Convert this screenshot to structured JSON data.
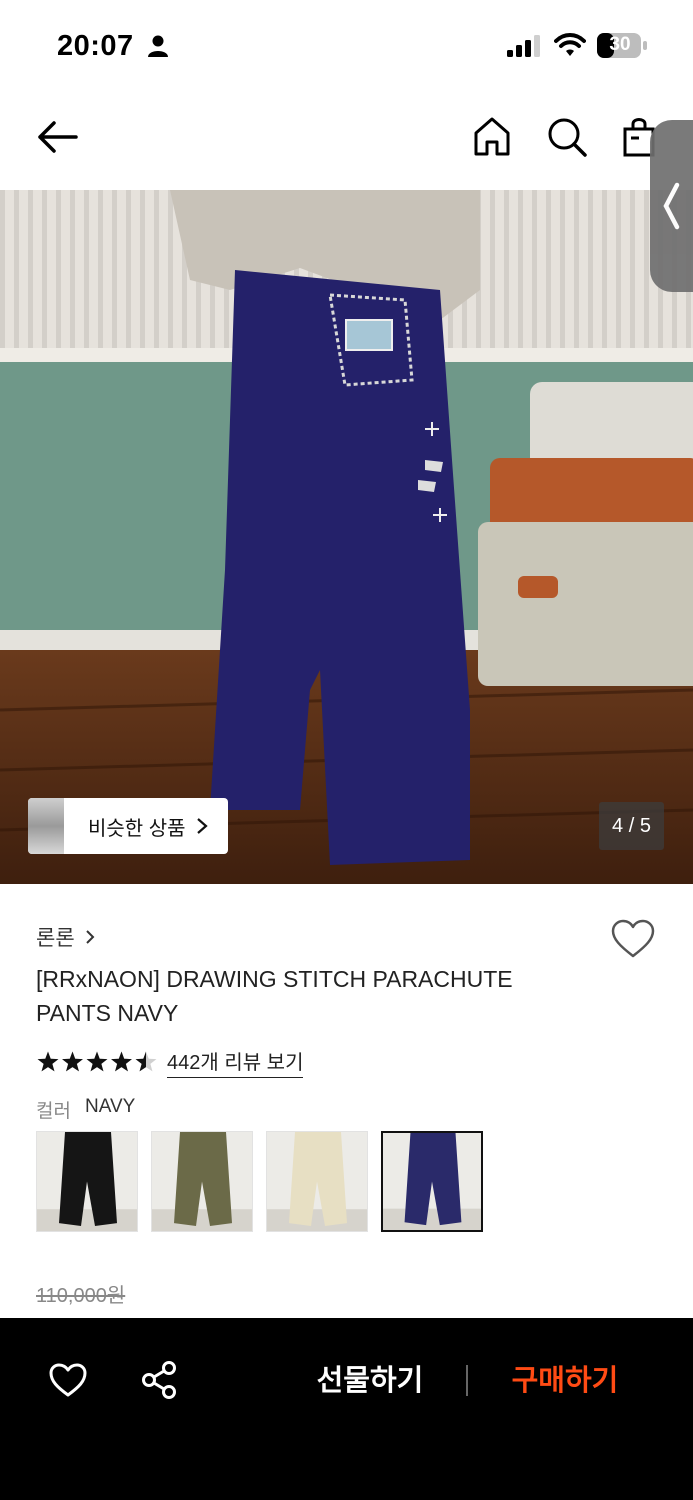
{
  "status_bar": {
    "time": "20:07",
    "battery": "30"
  },
  "nav": {
    "icons": [
      "back-arrow-icon",
      "home-icon",
      "search-icon",
      "shopping-bag-icon",
      "chevron-left-icon"
    ]
  },
  "hero": {
    "similar_label": "비슷한 상품",
    "page_indicator": "4 / 5"
  },
  "product": {
    "brand": "론론",
    "title": "[RRxNAON] DRAWING STITCH PARACHUTE PANTS NAVY",
    "rating_stars": 4.5,
    "review_link": "442개 리뷰 보기",
    "color_label": "컬러",
    "color_value": "NAVY",
    "swatch_colors": [
      "#151515",
      "#6b6a48",
      "#e7dfc3",
      "#2a2a6a"
    ],
    "selected_swatch": 3,
    "original_price": "110,000원"
  },
  "bottom_bar": {
    "gift_label": "선물하기",
    "buy_label": "구매하기",
    "buy_color": "#ff4b14"
  }
}
